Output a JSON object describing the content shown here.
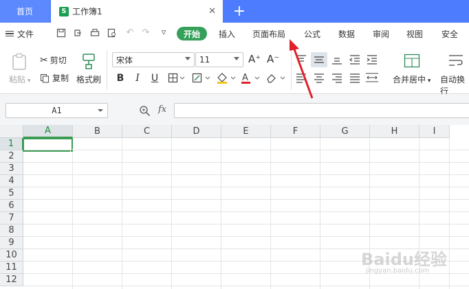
{
  "tabs": {
    "home_label": "首页",
    "doc_label": "工作簿1",
    "doc_icon_letter": "S",
    "close_glyph": "✕",
    "add_glyph": "+"
  },
  "menu": {
    "file_label": "文件",
    "start_label": "开始",
    "items": [
      "插入",
      "页面布局",
      "公式",
      "数据",
      "审阅",
      "视图",
      "安全"
    ]
  },
  "ribbon": {
    "paste_label": "粘贴",
    "cut_label": "剪切",
    "copy_label": "复制",
    "format_painter_label": "格式刷",
    "font_name": "宋体",
    "font_size": "11",
    "grow_font_glyph": "A⁺",
    "shrink_font_glyph": "A⁻",
    "bold_glyph": "B",
    "italic_glyph": "I",
    "underline_glyph": "U",
    "merge_label": "合并居中",
    "wrap_label": "自动换行"
  },
  "formula_bar": {
    "cell_ref": "A1",
    "fx_label": "fx",
    "formula_value": ""
  },
  "grid": {
    "columns": [
      "A",
      "B",
      "C",
      "D",
      "E",
      "F",
      "G",
      "H",
      "I"
    ],
    "rows": [
      "1",
      "2",
      "3",
      "4",
      "5",
      "6",
      "7",
      "8",
      "9",
      "10",
      "11",
      "12"
    ],
    "selected_cell": "A1"
  },
  "watermark": {
    "text": "Baidu经验",
    "subtext": "jingyan.baidu.com"
  },
  "colors": {
    "tab_blue": "#4d7cfe",
    "start_green": "#35a05a",
    "selection_green": "#3b9b52",
    "arrow_red": "#e0202a"
  }
}
